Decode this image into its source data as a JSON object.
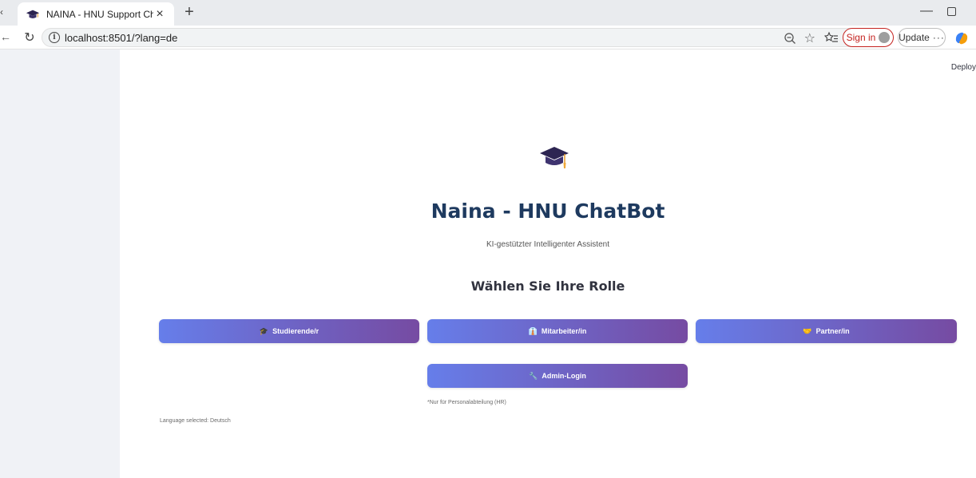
{
  "browser": {
    "tab_title": "NAINA - HNU Support Chat",
    "tab_close": "×",
    "new_tab": "+",
    "url": "localhost:8501/?lang=de",
    "sign_in_label": "Sign in",
    "update_label": "Update",
    "more_label": "···",
    "minimize": "—"
  },
  "page": {
    "deploy_label": "Deploy",
    "title": "Naina - HNU ChatBot",
    "subtitle": "KI-gestützter Intelligenter Assistent",
    "role_heading": "Wählen Sie Ihre Rolle",
    "roles": {
      "student": {
        "emoji": "🎓",
        "label": "Studierende/r"
      },
      "staff": {
        "emoji": "👔",
        "label": "Mitarbeiter/in"
      },
      "partner": {
        "emoji": "🤝",
        "label": "Partner/in"
      }
    },
    "admin": {
      "emoji": "🔧",
      "label": "Admin-Login",
      "note": "*Nur für Personalabteilung (HR)"
    },
    "language_status": "Language selected: Deutsch"
  },
  "colors": {
    "button_gradient_start": "#667eea",
    "button_gradient_end": "#764ba2",
    "title_color": "#1e3a5f",
    "sidebar_bg": "#f0f2f6",
    "sign_in_accent": "#c4221f"
  },
  "icons": {
    "tab_favicon": "graduation-cap-icon",
    "hero": "graduation-cap-icon"
  }
}
